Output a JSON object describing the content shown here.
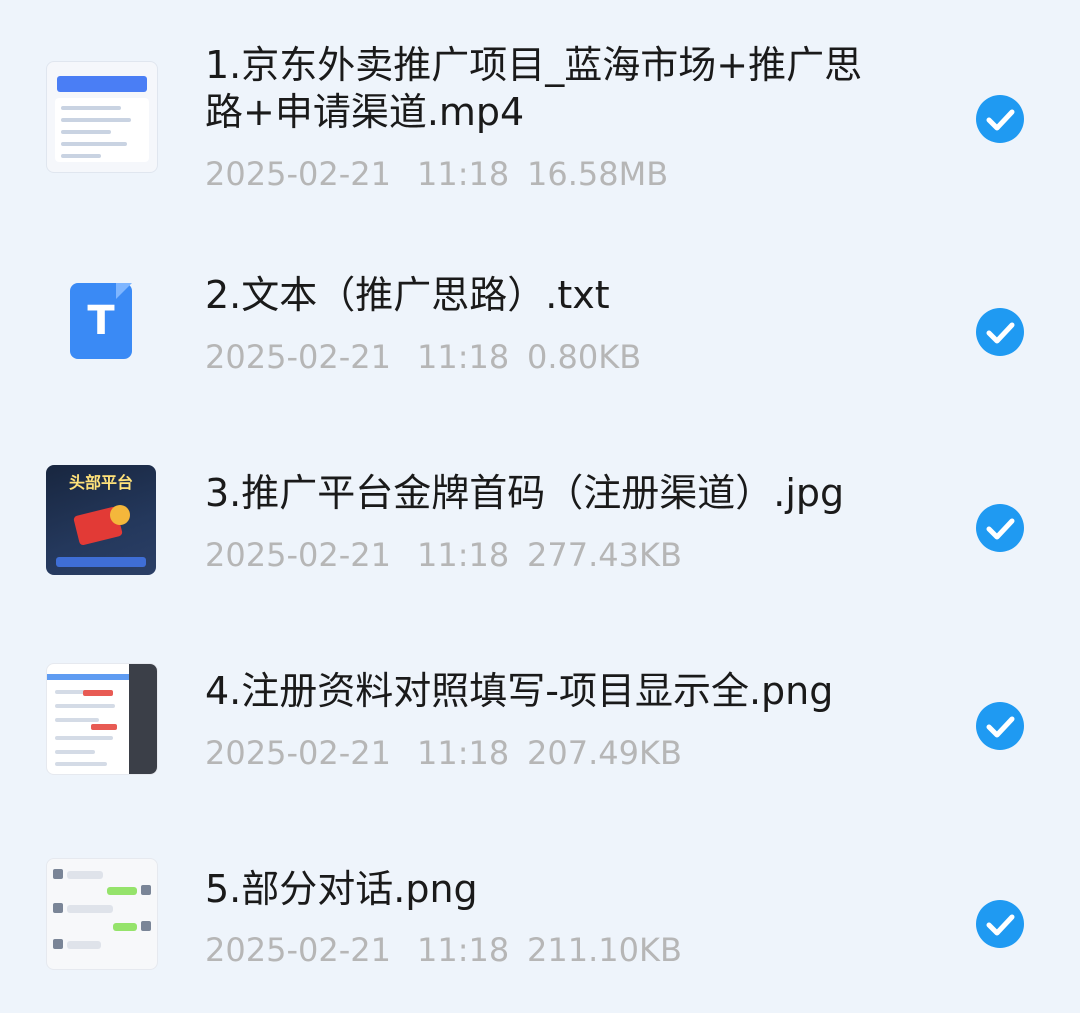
{
  "files": [
    {
      "name": "1.京东外卖推广项目_蓝海市场+推广思\n路+申请渠道.mp4",
      "date": "2025-02-21",
      "time": "11:18",
      "size": "16.58MB",
      "thumb_type": "video-screenshot",
      "selected": true
    },
    {
      "name": "2.文本（推广思路）.txt",
      "date": "2025-02-21",
      "time": "11:18",
      "size": "0.80KB",
      "thumb_type": "text-file-icon",
      "icon_letter": "T",
      "selected": true
    },
    {
      "name": "3.推广平台金牌首码（注册渠道）.jpg",
      "date": "2025-02-21",
      "time": "11:18",
      "size": "277.43KB",
      "thumb_type": "poster-image",
      "thumb_text": "头部平台",
      "selected": true
    },
    {
      "name": "4.注册资料对照填写-项目显示全.png",
      "date": "2025-02-21",
      "time": "11:18",
      "size": "207.49KB",
      "thumb_type": "form-screenshot",
      "selected": true
    },
    {
      "name": "5.部分对话.png",
      "date": "2025-02-21",
      "time": "11:18",
      "size": "211.10KB",
      "thumb_type": "chat-screenshot",
      "selected": true
    }
  ],
  "colors": {
    "background": "#eef4fb",
    "name_text": "#1a1a1a",
    "meta_text": "#b6b6b6",
    "check_fill": "#1f9af2",
    "text_icon": "#3a8af5"
  },
  "icons": {
    "check": "check-circle-icon",
    "text_file": "text-file-icon"
  }
}
